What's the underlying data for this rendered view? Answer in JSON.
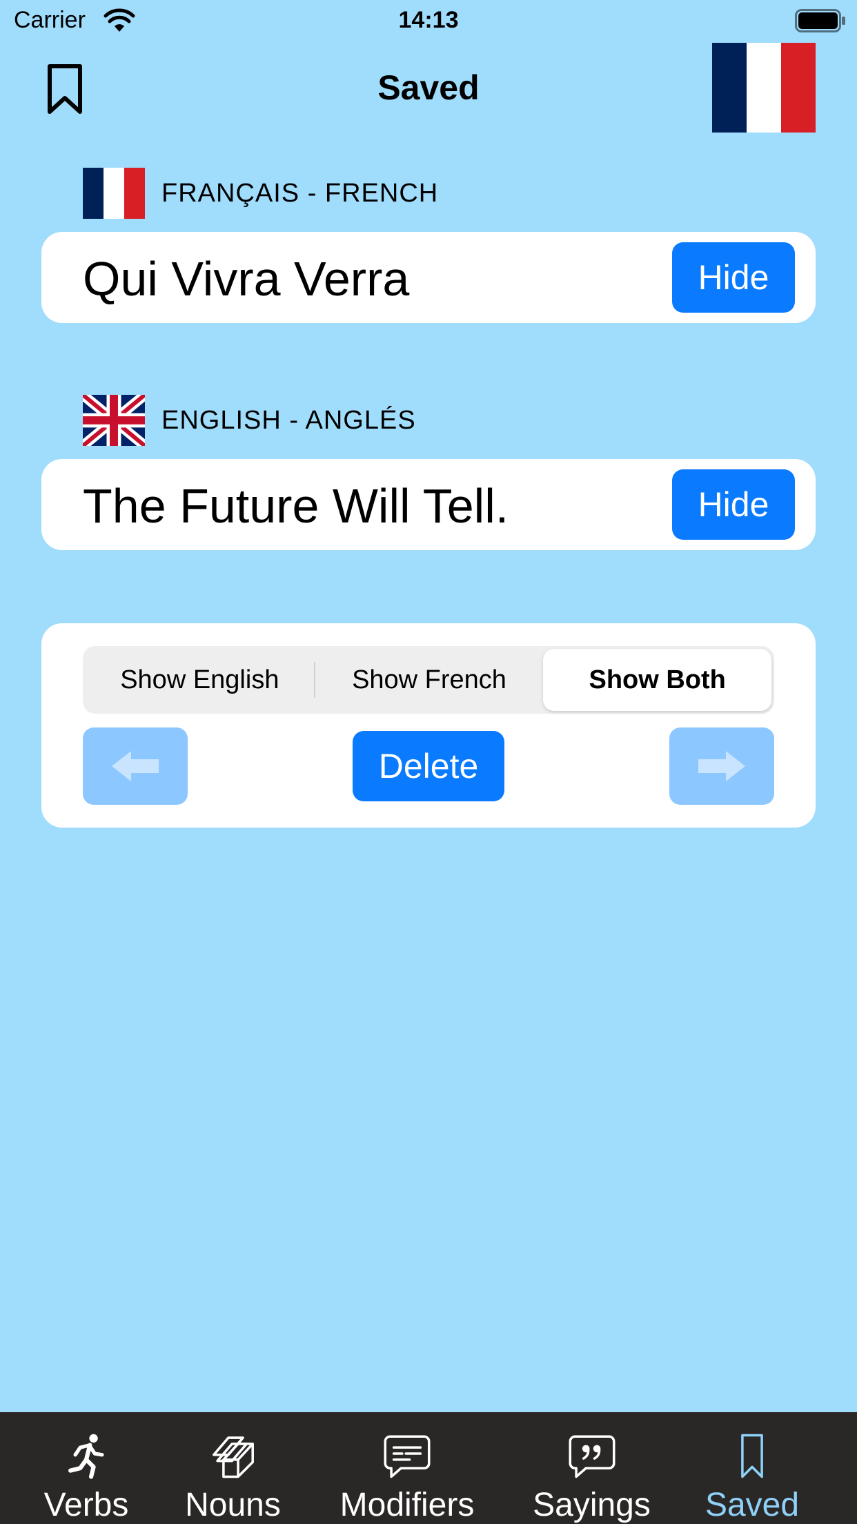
{
  "status_bar": {
    "carrier": "Carrier",
    "time": "14:13"
  },
  "nav": {
    "title": "Saved",
    "left_icon": "bookmark-icon",
    "right_icon": "france-flag"
  },
  "french": {
    "label": "FRANÇAIS - FRENCH",
    "phrase": "Qui Vivra Verra",
    "hide_label": "Hide"
  },
  "english": {
    "label": "ENGLISH - ANGLÉS",
    "phrase": "The Future Will Tell.",
    "hide_label": "Hide"
  },
  "controls": {
    "segments": [
      "Show English",
      "Show French",
      "Show Both"
    ],
    "selected_segment": "Show Both",
    "delete_label": "Delete",
    "prev_icon": "arrow-left-icon",
    "next_icon": "arrow-right-icon"
  },
  "tabs": [
    {
      "label": "Verbs",
      "icon": "running-person-icon"
    },
    {
      "label": "Nouns",
      "icon": "cubes-icon"
    },
    {
      "label": "Modifiers",
      "icon": "text-bubble-icon"
    },
    {
      "label": "Sayings",
      "icon": "quote-bubble-icon"
    },
    {
      "label": "Saved",
      "icon": "bookmark-icon",
      "active": true
    }
  ],
  "colors": {
    "background": "#a0dcfc",
    "accent": "#0a7aff",
    "disabled_button": "#8cc7ff",
    "tab_bar": "#2a2826",
    "tab_active": "#8fd1f8"
  }
}
